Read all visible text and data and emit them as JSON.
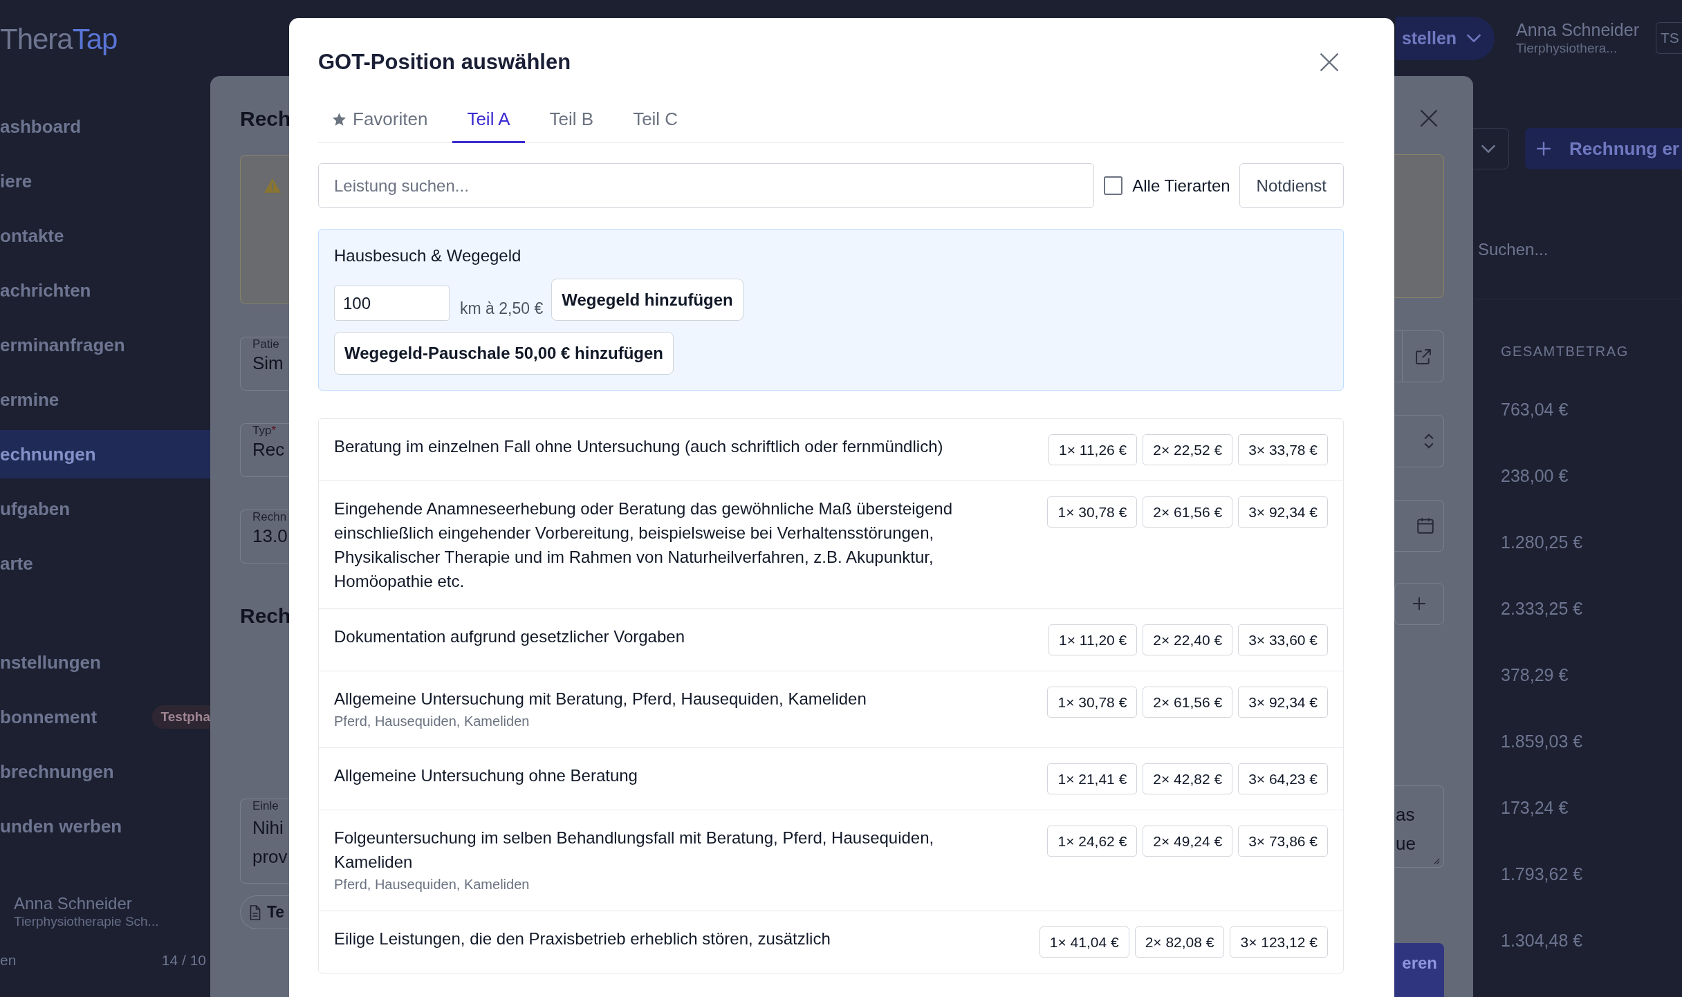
{
  "app": {
    "logo": {
      "text": "Thera",
      "accent": "Tap"
    },
    "sidebar": {
      "nav": {
        "main": [
          {
            "label": "ashboard",
            "selected": false
          },
          {
            "label": "iere",
            "selected": false
          },
          {
            "label": "ontakte",
            "selected": false
          },
          {
            "label": "achrichten",
            "selected": false
          },
          {
            "label": "erminanfragen",
            "selected": false
          },
          {
            "label": "ermine",
            "selected": false
          },
          {
            "label": "echnungen",
            "selected": true
          },
          {
            "label": "ufgaben",
            "selected": false
          },
          {
            "label": "arte",
            "selected": false
          }
        ],
        "secondary": [
          {
            "label": "nstellungen",
            "selected": false
          },
          {
            "label": "bonnement",
            "selected": false,
            "badge": "Testpha"
          },
          {
            "label": "brechnungen",
            "selected": false
          },
          {
            "label": "unden werben",
            "selected": false
          }
        ]
      },
      "user": {
        "name": "Anna Schneider",
        "subtitle": "Tierphysiotherapie Sch..."
      },
      "footer": {
        "label": "en",
        "count": "14 / 10"
      }
    },
    "header": {
      "menu_button": "stellen",
      "user": {
        "name": "Anna Schneider",
        "subtitle": "Tierphysiothera..."
      },
      "avatar": "TS"
    },
    "toolbar": {
      "create_button": "Rechnung er",
      "search": {
        "placeholder": "Suchen..."
      }
    },
    "table": {
      "columns": [
        "GESAMTBETRAG"
      ],
      "rows": [
        [
          "763,04 €"
        ],
        [
          "238,00 €"
        ],
        [
          "1.280,25 €"
        ],
        [
          "2.333,25 €"
        ],
        [
          "378,29 €"
        ],
        [
          "1.859,03 €"
        ],
        [
          "173,24 €"
        ],
        [
          "1.793,62 €"
        ],
        [
          "1.304,48 €"
        ]
      ]
    }
  },
  "background_dialog": {
    "title": "Rech",
    "fields": [
      {
        "kind": "link",
        "label": "Patie",
        "value": "Sim"
      },
      {
        "kind": "select",
        "label": "Typ",
        "required_mark": "*",
        "value": "Rec"
      },
      {
        "kind": "date",
        "label": "Rechn",
        "value": "13.0"
      }
    ],
    "section_title": "Rech",
    "notes": {
      "label": "Einle",
      "lines": [
        {
          "start": "Nihi",
          "end": "as"
        },
        {
          "start": "prov",
          "end": "ue"
        }
      ]
    },
    "attach_button": "Te",
    "submit_button": "eren"
  },
  "dialog": {
    "title": "GOT-Position auswählen",
    "tabs": [
      {
        "label": "Favoriten",
        "kind": "favorites",
        "selected": false
      },
      {
        "label": "Teil A",
        "kind": "part",
        "selected": true
      },
      {
        "label": "Teil B",
        "kind": "part",
        "selected": false
      },
      {
        "label": "Teil C",
        "kind": "part",
        "selected": false
      }
    ],
    "search": {
      "placeholder": "Leistung suchen..."
    },
    "all_species": {
      "label": "Alle Tierarten",
      "checked": false
    },
    "emergency_button": "Notdienst",
    "travel": {
      "title": "Hausbesuch & Wegegeld",
      "distance": {
        "value": "100"
      },
      "rate": "km à 2,50 €",
      "add_button": "Wegegeld hinzufügen",
      "flat_button": "Wegegeld-Pauschale 50,00 € hinzufügen"
    },
    "positions": [
      {
        "description": "Beratung im einzelnen Fall ohne Untersuchung (auch schriftlich oder fernmündlich)",
        "prices": [
          "1× 11,26 €",
          "2× 22,52 €",
          "3× 33,78 €"
        ]
      },
      {
        "description": "Eingehende Anamneseerhebung oder Beratung das gewöhnliche Maß übersteigend einschließlich eingehender Vorbereitung, beispielsweise bei Verhaltensstörungen, Physikalischer Therapie und im Rahmen von Naturheilverfahren, z.B. Akupunktur, Homöopathie etc.",
        "prices": [
          "1× 30,78 €",
          "2× 61,56 €",
          "3× 92,34 €"
        ]
      },
      {
        "description": "Dokumentation aufgrund gesetzlicher Vorgaben",
        "prices": [
          "1× 11,20 €",
          "2× 22,40 €",
          "3× 33,60 €"
        ]
      },
      {
        "description": "Allgemeine Untersuchung mit Beratung, Pferd, Hausequiden, Kameliden",
        "species": "Pferd, Hausequiden, Kameliden",
        "prices": [
          "1× 30,78 €",
          "2× 61,56 €",
          "3× 92,34 €"
        ]
      },
      {
        "description": "Allgemeine Untersuchung ohne Beratung",
        "prices": [
          "1× 21,41 €",
          "2× 42,82 €",
          "3× 64,23 €"
        ]
      },
      {
        "description": "Folgeuntersuchung im selben Behandlungsfall mit Beratung, Pferd, Hausequiden, Kameliden",
        "species": "Pferd, Hausequiden, Kameliden",
        "prices": [
          "1× 24,62 €",
          "2× 49,24 €",
          "3× 73,86 €"
        ]
      },
      {
        "description": "Eilige Leistungen, die den Praxisbetrieb erheblich stören, zusätzlich",
        "prices": [
          "1× 41,04 €",
          "2× 82,08 €",
          "3× 123,12 €"
        ]
      }
    ]
  }
}
